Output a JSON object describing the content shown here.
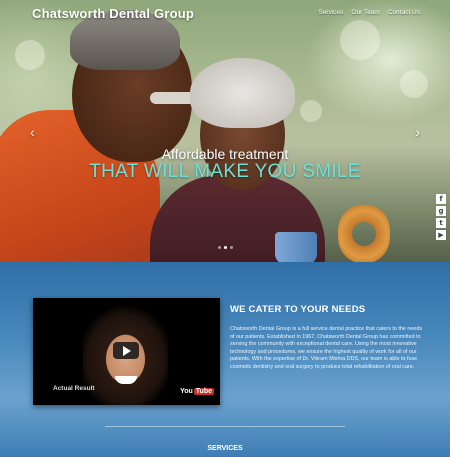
{
  "header": {
    "site_title": "Chatsworth Dental Group",
    "nav": [
      "Services",
      "Our Team",
      "Contact Us"
    ]
  },
  "hero": {
    "tagline_line1": "Affordable treatment",
    "tagline_line2": "THAT WILL MAKE YOU SMILE",
    "prev_arrow": "‹",
    "next_arrow": "›",
    "slide_count": 3,
    "active_slide": 2
  },
  "social": [
    {
      "icon": "facebook-icon",
      "glyph": "f"
    },
    {
      "icon": "google-plus-icon",
      "glyph": "g"
    },
    {
      "icon": "twitter-icon",
      "glyph": "t"
    },
    {
      "icon": "youtube-icon",
      "glyph": "▶"
    }
  ],
  "video": {
    "caption": "Actual Result",
    "brand_you": "You",
    "brand_tube": "Tube"
  },
  "about": {
    "title": "WE CATER TO YOUR NEEDS",
    "body": "Chatsworth Dental Group is a full service dental practice that caters to the needs of our patients. Established in 1967, Chatsworth Dental Group has committed to serving the community with exceptional dental care. Using the most innovative technology and procedures, we ensure the highest quality of work for all of our patients. With the expertise of Dr. Vikram Mishra DDS, our team is able to fuse cosmetic dentistry and oral surgery to produce total rehabilitation of oral care."
  },
  "services_heading": "SERVICES",
  "colors": {
    "accent": "#6ee0d8",
    "section_blue": "#4a89bd"
  }
}
